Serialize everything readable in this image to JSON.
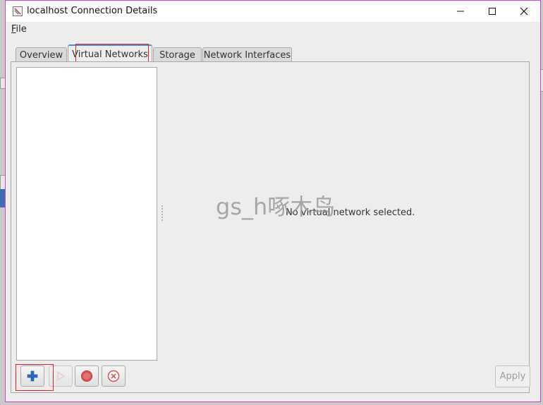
{
  "window": {
    "title": "localhost Connection Details",
    "controls": {
      "minimize": "–",
      "maximize": "□",
      "close": "✕"
    }
  },
  "menubar": {
    "file_mnemonic": "F",
    "file_rest": "ile"
  },
  "tabs": [
    {
      "label": "Overview"
    },
    {
      "label": "Virtual Networks",
      "active": true
    },
    {
      "label": "Storage"
    },
    {
      "label": "Network Interfaces"
    }
  ],
  "main": {
    "empty_message": "No virtual network selected.",
    "watermark": "gs_h啄木鸟"
  },
  "toolbar": {
    "add_icon": "plus-icon",
    "start_icon": "play-icon",
    "stop_icon": "stop-icon",
    "delete_icon": "delete-icon",
    "apply_label": "Apply"
  },
  "colors": {
    "window_border": "#d240d2",
    "active_tab_accent": "#4a90d9",
    "highlight_box": "#e02424",
    "add_icon": "#2e6bc4",
    "stop_icon": "#d9534f"
  }
}
